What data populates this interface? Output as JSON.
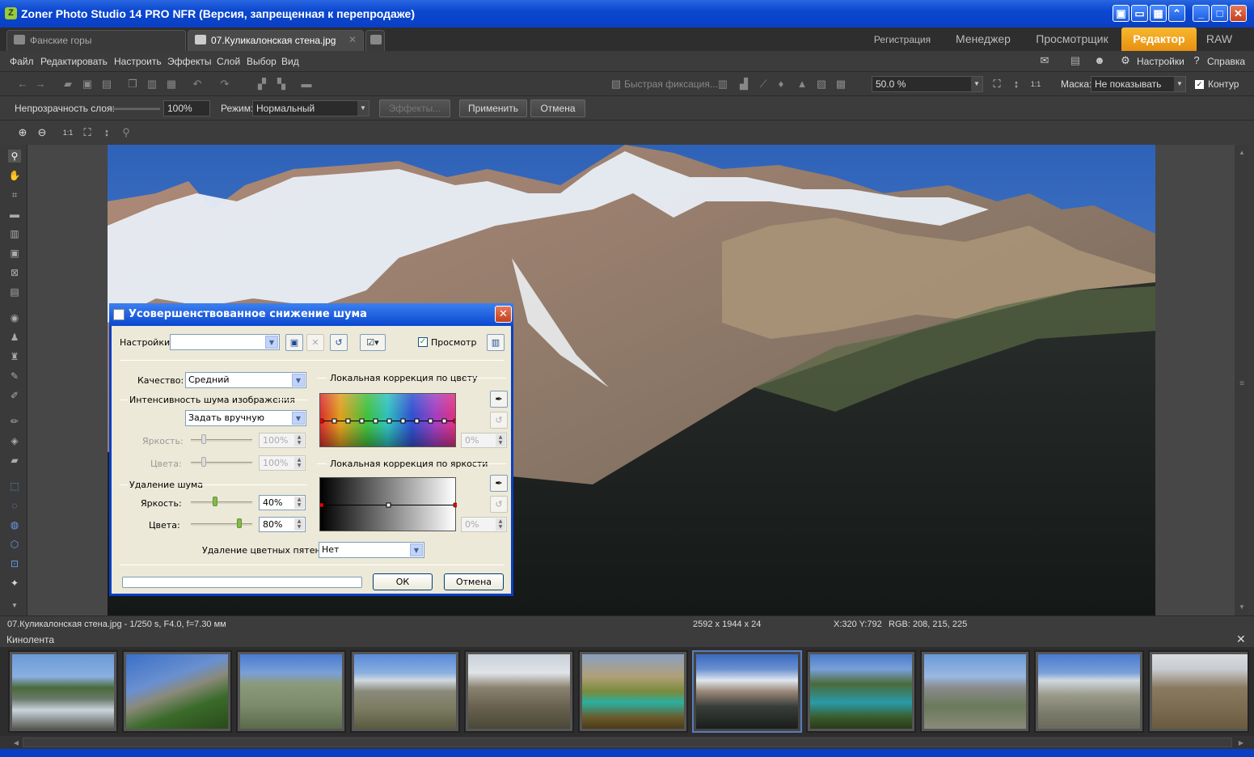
{
  "window": {
    "title": "Zoner Photo Studio 14 PRO NFR (Версия, запрещенная к перепродаже)"
  },
  "doc_tabs": [
    {
      "label": "Фанские горы"
    },
    {
      "label": "07.Куликалонская стена.jpg"
    }
  ],
  "mode_tabs": [
    {
      "label": "Регистрация"
    },
    {
      "label": "Менеджер"
    },
    {
      "label": "Просмотрщик"
    },
    {
      "label": "Редактор"
    },
    {
      "label": "RAW"
    }
  ],
  "menu": [
    "Файл",
    "Редактировать",
    "Настроить",
    "Эффекты",
    "Слой",
    "Выбор",
    "Вид"
  ],
  "menu_right": {
    "settings": "Настройки",
    "help": "Справка"
  },
  "toolbar": {
    "quick_fix": "Быстрая фиксация...",
    "zoom_value": "50.0 %",
    "mask_label": "Маска:",
    "mask_value": "Не показывать",
    "contour_label": "Контур"
  },
  "optbar": {
    "opacity_label": "Непрозрачность слоя:",
    "opacity_value": "100%",
    "mode_label": "Режим:",
    "mode_value": "Нормальный",
    "effects_btn": "Эффекты...",
    "apply_btn": "Применить",
    "cancel_btn": "Отмена"
  },
  "status": {
    "file_info": "07.Куликалонская стена.jpg - 1/250 s, F4.0, f=7.30 мм",
    "dimensions": "2592 x 1944 x 24",
    "coords": "X:320 Y:792",
    "rgb": "RGB: 208, 215, 225"
  },
  "filmstrip": {
    "title": "Кинолента",
    "selected_index": 6
  },
  "dialog": {
    "title": "Усовершенствованное снижение шума",
    "settings_label": "Настройки:",
    "settings_value": "",
    "preview_label": "Просмотр",
    "preview_checked": true,
    "quality_label": "Качество:",
    "quality_value": "Средний",
    "intensity_header": "Интенсивность шума изображения",
    "intensity_mode": "Задать вручную",
    "intensity_brightness_label": "Яркость:",
    "intensity_brightness_value": "100%",
    "intensity_colors_label": "Цвета:",
    "intensity_colors_value": "100%",
    "removal_header": "Удаление шума",
    "removal_brightness_label": "Яркость:",
    "removal_brightness_value": "40%",
    "removal_colors_label": "Цвета:",
    "removal_colors_value": "80%",
    "color_spots_label": "Удаление цветных пятен:",
    "color_spots_value": "Нет",
    "local_color_header": "Локальная коррекция по цвету",
    "local_color_value": "0%",
    "local_brightness_header": "Локальная коррекция по яркости",
    "local_brightness_value": "0%",
    "ok_btn": "ОК",
    "cancel_btn": "Отмена"
  },
  "colors": {
    "accent_tab": "#f0a020",
    "titlebar": "#0a48d0",
    "dialog_bg": "#ece9d8"
  }
}
